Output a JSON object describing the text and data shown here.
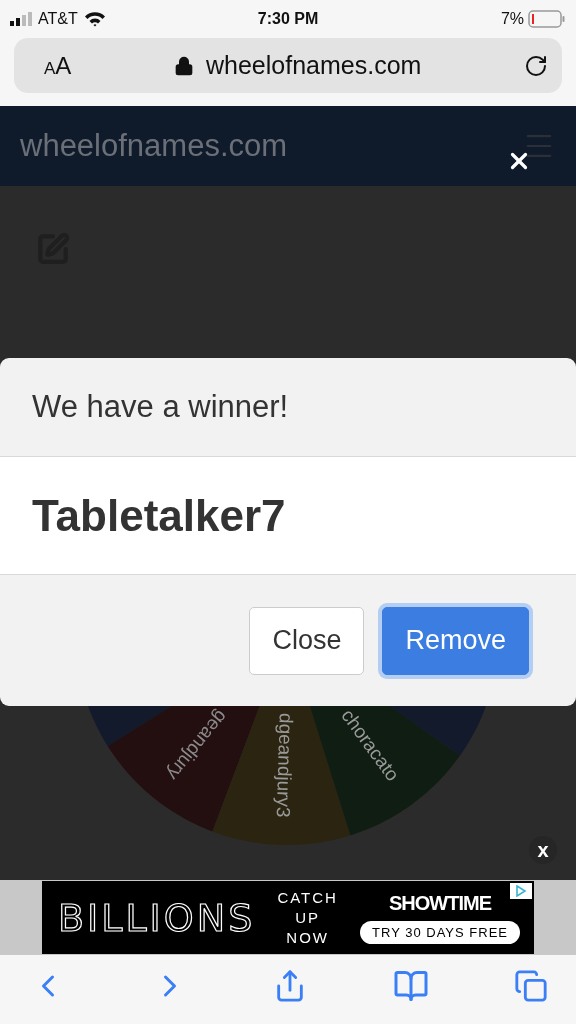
{
  "status_bar": {
    "carrier": "AT&T",
    "time": "7:30 PM",
    "battery": "7%"
  },
  "address_bar": {
    "text_size": "AA",
    "url": "wheelofnames.com"
  },
  "site_header": {
    "logo": "wheelofnames.com"
  },
  "wheel": {
    "sectors": [
      {
        "color": "#121a2c"
      },
      {
        "color": "#230e10",
        "label": "geandjury"
      },
      {
        "color": "#2a2410",
        "label": "dgeandjury3"
      },
      {
        "color": "#0f1d12",
        "label": "choracato"
      },
      {
        "color": "#121a2c"
      }
    ]
  },
  "dialog": {
    "title": "We have a winner!",
    "winner": "Tabletalker7",
    "buttons": [
      {
        "label": "Close",
        "kind": "secondary"
      },
      {
        "label": "Remove",
        "kind": "primary"
      }
    ]
  },
  "ad": {
    "title": "BILLIONS",
    "tagline": "CATCH UP NOW",
    "brand": "SHOWTIME",
    "cta": "TRY 30 DAYS FREE",
    "close": "x"
  }
}
